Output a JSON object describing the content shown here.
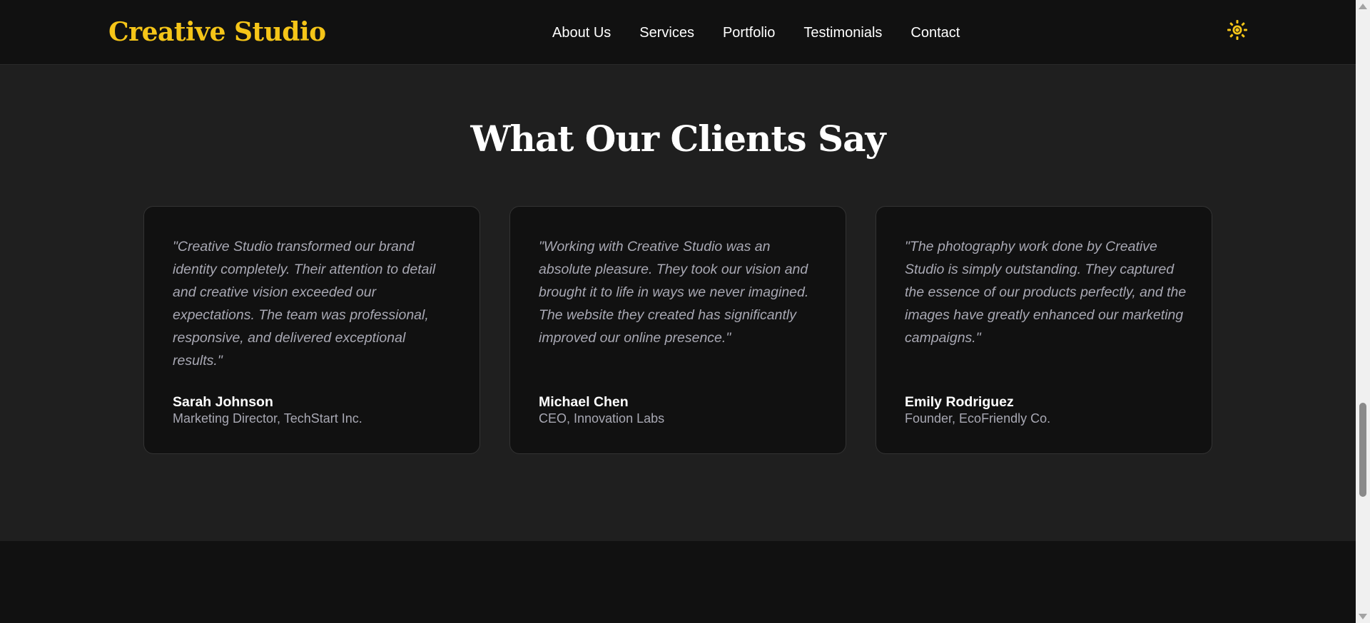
{
  "header": {
    "logo": "Creative Studio",
    "nav": [
      {
        "label": "About Us"
      },
      {
        "label": "Services"
      },
      {
        "label": "Portfolio"
      },
      {
        "label": "Testimonials"
      },
      {
        "label": "Contact"
      }
    ],
    "theme_icon": "sun-icon"
  },
  "testimonials": {
    "title": "What Our Clients Say",
    "items": [
      {
        "quote": "\"Creative Studio transformed our brand identity completely. Their attention to detail and creative vision exceeded our expectations. The team was professional, responsive, and delivered exceptional results.\"",
        "name": "Sarah Johnson",
        "role": "Marketing Director, TechStart Inc."
      },
      {
        "quote": "\"Working with Creative Studio was an absolute pleasure. They took our vision and brought it to life in ways we never imagined. The website they created has significantly improved our online presence.\"",
        "name": "Michael Chen",
        "role": "CEO, Innovation Labs"
      },
      {
        "quote": "\"The photography work done by Creative Studio is simply outstanding. They captured the essence of our products perfectly, and the images have greatly enhanced our marketing campaigns.\"",
        "name": "Emily Rodriguez",
        "role": "Founder, EcoFriendly Co."
      }
    ]
  },
  "colors": {
    "accent": "#f5c518",
    "header_bg": "#111111",
    "section_bg": "#1f1f1f",
    "card_bg": "#111111",
    "muted_text": "#a8a8b3"
  }
}
